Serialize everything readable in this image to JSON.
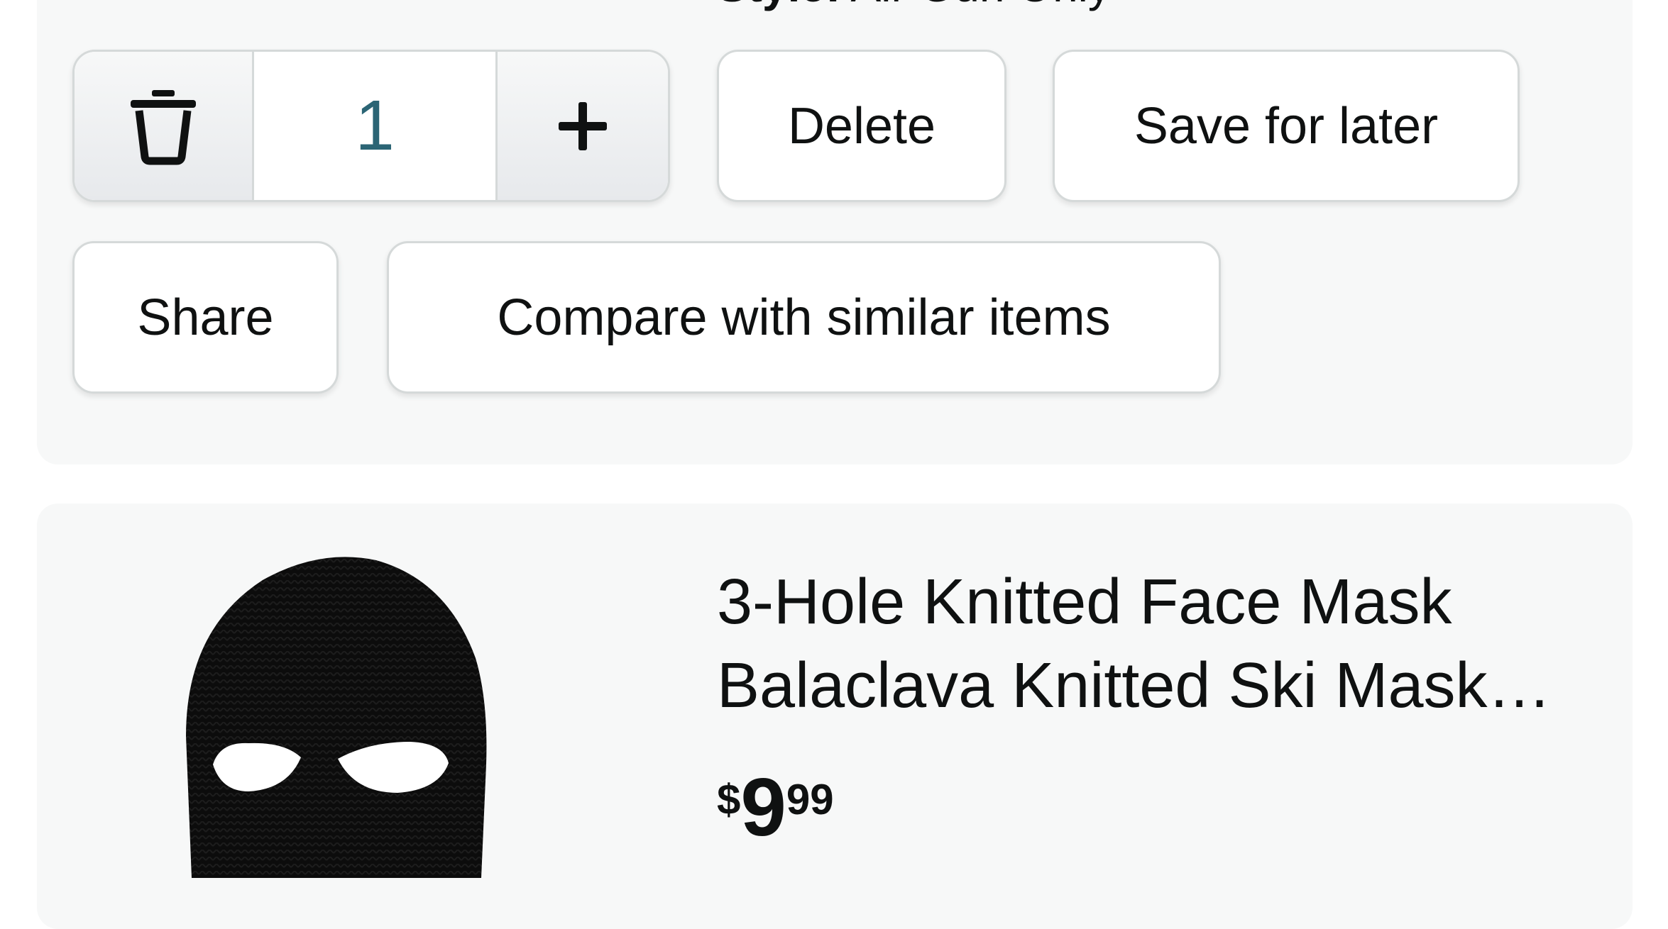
{
  "item_above": {
    "style_key": "Style:",
    "style_value": "Air Gun Only",
    "quantity": "1",
    "delete_label": "Delete",
    "save_for_later_label": "Save for later",
    "share_label": "Share",
    "compare_label": "Compare with similar items"
  },
  "item": {
    "title_line1": "3-Hole Knitted Face Mask",
    "title_line2": "Balaclava Knitted Ski Mask…",
    "price_symbol": "$",
    "price_whole": "9",
    "price_fraction": "99"
  },
  "colors": {
    "card_bg": "#f7f8f8",
    "button_border": "#d5d9d9",
    "qty_text": "#2b6575",
    "text": "#0f1111"
  },
  "icons": {
    "trash": "trash-icon",
    "plus": "plus-icon"
  }
}
